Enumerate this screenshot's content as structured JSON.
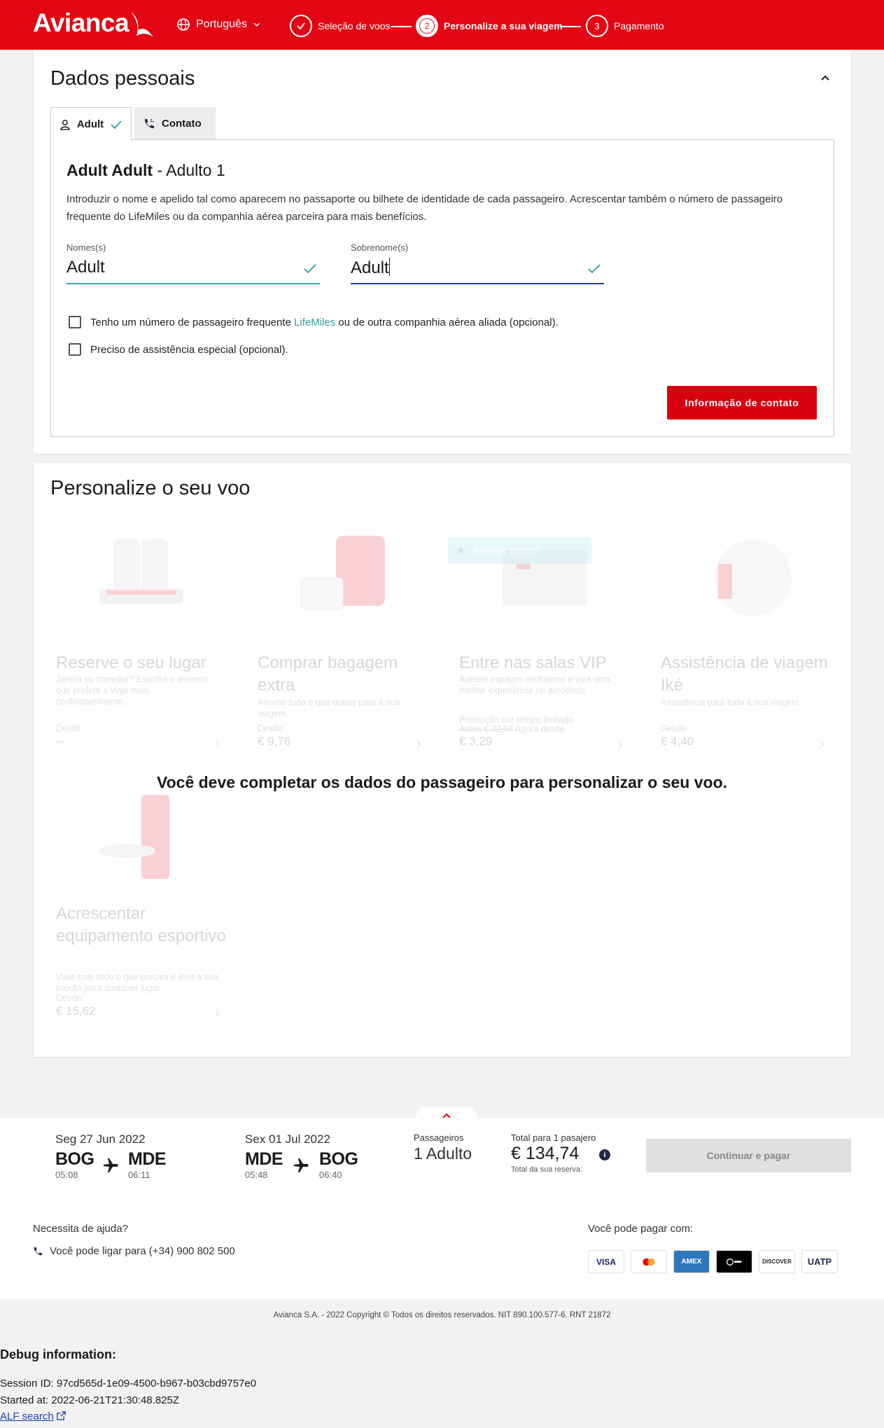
{
  "header": {
    "logo": "Avianca",
    "language": "Português",
    "steps": [
      {
        "num": "",
        "label": "Seleção de voos"
      },
      {
        "num": "2",
        "label": "Personalize a sua viagem"
      },
      {
        "num": "3",
        "label": "Pagamento"
      }
    ]
  },
  "personal": {
    "title": "Dados pessoais",
    "tabs": [
      {
        "label": "Adult"
      },
      {
        "label": "Contato"
      }
    ],
    "passenger_name": "Adult Adult",
    "passenger_role": " - Adulto 1",
    "description": "Introduzir o nome e apelido tal como aparecem no passaporte ou bilhete de identidade de cada passageiro. Acrescentar também o número de passageiro frequente do LifeMiles ou da companhia aérea parceira para mais benefícios.",
    "first_name_label": "Nomes(s)",
    "first_name_value": "Adult",
    "last_name_label": "Sobrenome(s)",
    "last_name_value": "Adult",
    "check1_pre": "Tenho um número de passageiro frequente ",
    "check1_link": "LifeMiles",
    "check1_post": " ou de outra companhia aérea aliada (opcional).",
    "check2": "Preciso de assistência especial (opcional).",
    "next_button": "Informação de contato"
  },
  "customize": {
    "title": "Personalize o seu voo",
    "message": "Você deve completar os dados do passageiro para personalizar o seu voo.",
    "badge": "Melhor preço!",
    "tiles": [
      {
        "title": "Reserve o seu lugar",
        "desc": "Janela ou corredor? Escolha o assento que prefere e viaje mais confortavelmente.",
        "from": "Desde",
        "price": "--"
      },
      {
        "title": "Comprar bagagem extra",
        "desc": "Arrume tudo o que quiser para a sua viagem.",
        "from": "Desde",
        "price": "€ 9,76"
      },
      {
        "title": "Entre nas salas VIP",
        "desc": "Acesse espaços exclusivos e viva uma melhor experiência no aeroporto",
        "promo": "Promoção por tempo limitado",
        "old": "Antes € 32,94",
        "from": " Agora desde",
        "price": "€ 3,29"
      },
      {
        "title": "Assistência de viagem Iké",
        "desc": "Assistência para toda a sua viagem",
        "from": "Desde",
        "price": "€ 4,40"
      },
      {
        "title": "Acrescentar equipamento esportivo",
        "desc": "Viaje com tudo o que precisa e leve a sua paixão para qualquer lugar.",
        "from": "Desde",
        "price": "€ 15,62"
      }
    ]
  },
  "summary": {
    "outbound": {
      "date": "Seg 27 Jun 2022",
      "from": "BOG",
      "to": "MDE",
      "dep": "05:08",
      "arr": "06:11"
    },
    "inbound": {
      "date": "Sex 01 Jul 2022",
      "from": "MDE",
      "to": "BOG",
      "dep": "05:48",
      "arr": "06:40"
    },
    "pax_label": "Passageiros",
    "pax_value": "1 Adulto",
    "total_label": "Total para 1 pasajero",
    "total_value": "€ 134,74",
    "total_sub": "Total da sua reserva:",
    "continue": "Continuar e pagar"
  },
  "footer": {
    "help_title": "Necessita de ajuda?",
    "help_phone": "Você pode ligar para (+34) 900 802 500",
    "pay_title": "Você pode pagar com:",
    "payment_methods": [
      "VISA",
      "",
      "AMEX",
      "",
      "DISCOVER",
      "UATP"
    ],
    "copyright": "Avianca S.A. - 2022 Copyright © Todos os direitos reservados. NIT 890.100.577-6. RNT 21872"
  },
  "debug": {
    "title": "Debug information:",
    "session": "Session ID: 97cd565d-1e09-4500-b967-b03cbd9757e0",
    "started": "Started at: 2022-06-21T21:30:48.825Z",
    "link": "ALF search"
  },
  "colors": {
    "brand": "#e30613",
    "teal": "#3aa8a4",
    "blue_underline": "#1f3fa5"
  }
}
